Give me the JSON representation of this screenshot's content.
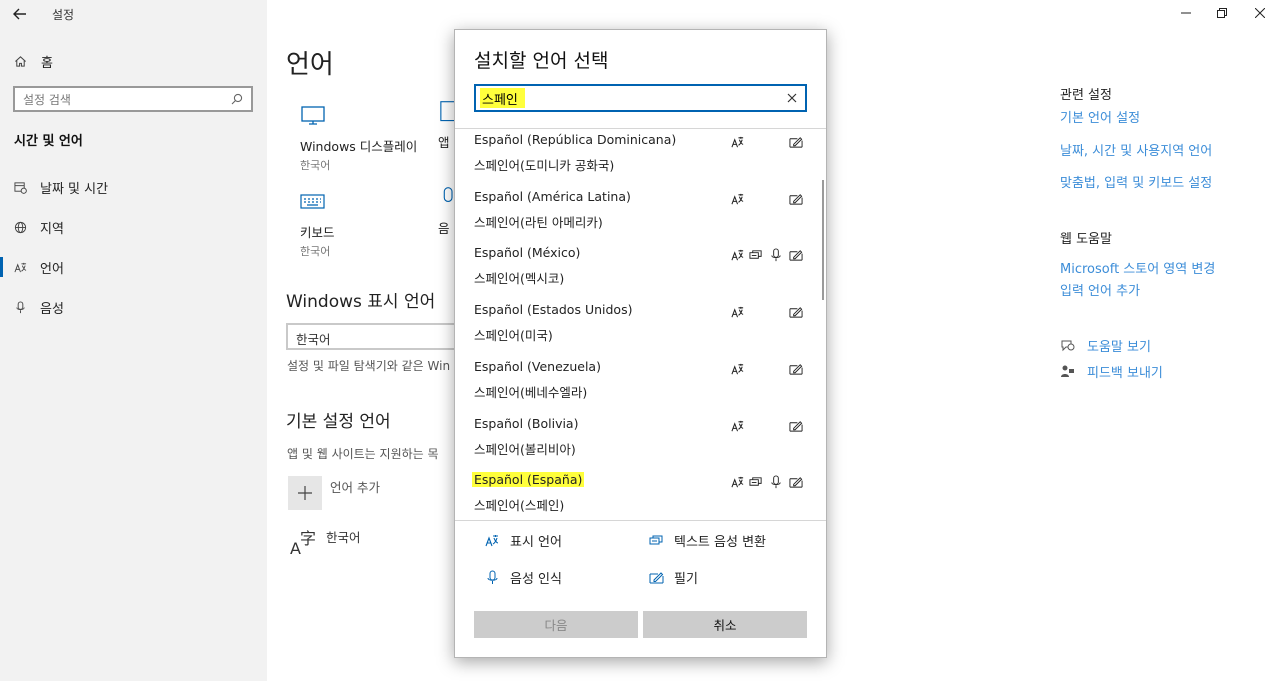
{
  "window": {
    "title": "설정"
  },
  "sidebar": {
    "home": "홈",
    "search_placeholder": "설정 검색",
    "section": "시간 및 언어",
    "items": [
      {
        "label": "날짜 및 시간",
        "icon": "calendar-clock-icon"
      },
      {
        "label": "지역",
        "icon": "globe-icon"
      },
      {
        "label": "언어",
        "icon": "language-icon",
        "active": true
      },
      {
        "label": "음성",
        "icon": "microphone-icon"
      }
    ]
  },
  "main": {
    "title": "언어",
    "tiles": [
      {
        "label": "Windows 디스플레이",
        "sub": "한국어"
      },
      {
        "label": "앱",
        "sub": ""
      },
      {
        "label": "키보드",
        "sub": "한국어"
      },
      {
        "label": "음",
        "sub": ""
      }
    ],
    "display_lang_heading": "Windows 표시 언어",
    "display_lang_value": "한국어",
    "display_lang_desc": "설정 및 파일 탐색기와 같은 Win",
    "preferred_heading": "기본 설정 언어",
    "preferred_desc": "앱 및 웹 사이트는 지원하는 목",
    "add_language": "언어 추가",
    "installed_language": "한국어"
  },
  "right": {
    "related_heading": "관련 설정",
    "related_links": [
      "기본 언어 설정",
      "날짜, 시간 및 사용지역 언어",
      "맞춤법, 입력 및 키보드 설정"
    ],
    "web_help_heading": "웹 도움말",
    "web_help_links": [
      "Microsoft 스토어 영역 변경",
      "입력 언어 추가"
    ],
    "help": "도움말 보기",
    "feedback": "피드백 보내기"
  },
  "dialog": {
    "title": "설치할 언어 선택",
    "search_value": "스페인",
    "languages": [
      {
        "name": "Español (República Dominicana)",
        "native": "스페인어(도미니카 공화국)",
        "features": [
          "display",
          "handwriting"
        ]
      },
      {
        "name": "Español (América Latina)",
        "native": "스페인어(라틴 아메리카)",
        "features": [
          "display",
          "handwriting"
        ]
      },
      {
        "name": "Español (México)",
        "native": "스페인어(멕시코)",
        "features": [
          "display",
          "tts",
          "speech",
          "handwriting"
        ]
      },
      {
        "name": "Español (Estados Unidos)",
        "native": "스페인어(미국)",
        "features": [
          "display",
          "handwriting"
        ]
      },
      {
        "name": "Español (Venezuela)",
        "native": "스페인어(베네수엘라)",
        "features": [
          "display",
          "handwriting"
        ]
      },
      {
        "name": "Español (Bolivia)",
        "native": "스페인어(볼리비아)",
        "features": [
          "display",
          "handwriting"
        ]
      },
      {
        "name": "Español (España)",
        "native": "스페인어(스페인)",
        "features": [
          "display",
          "tts",
          "speech",
          "handwriting"
        ],
        "highlighted": true
      }
    ],
    "legend": {
      "display": "표시 언어",
      "tts": "텍스트 음성 변환",
      "speech": "음성 인식",
      "handwriting": "필기"
    },
    "next_button": "다음",
    "cancel_button": "취소"
  },
  "colors": {
    "accent": "#0063b1",
    "link": "#3c8dd8",
    "highlight": "#ffff3c",
    "sidebar_bg": "#f2f2f2"
  }
}
